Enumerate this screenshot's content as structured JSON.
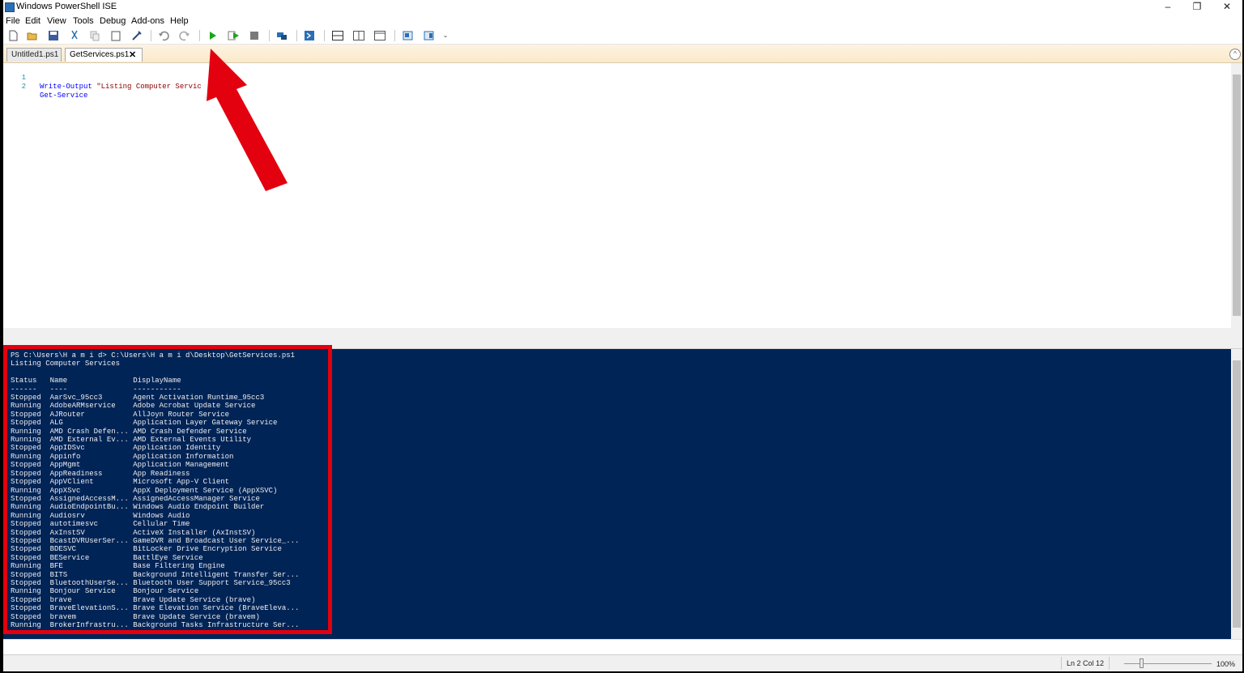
{
  "window": {
    "title": "Windows PowerShell ISE",
    "controls": [
      "–",
      "❐",
      "✕"
    ]
  },
  "menu": {
    "items": [
      "File",
      "Edit",
      "View",
      "Tools",
      "Debug",
      "Add-ons",
      "Help"
    ]
  },
  "toolbar": {
    "icons": [
      "new-icon",
      "open-icon",
      "save-icon",
      "cut-icon",
      "copy-icon",
      "paste-icon",
      "clear-console-icon",
      "undo-icon",
      "redo-icon",
      "run-script-icon",
      "run-selection-icon",
      "stop-icon",
      "remote-powershell-icon",
      "powershell-console-icon",
      "show-script-pane-top-icon",
      "show-script-pane-right-icon",
      "show-script-pane-maximized-icon",
      "show-command-window-icon",
      "show-command-addon-icon",
      "customize-toolbar-icon"
    ],
    "run_color": "#1aa51a"
  },
  "tabs": [
    {
      "label": "Untitled1.ps1",
      "active": false
    },
    {
      "label": "GetServices.ps1",
      "active": true,
      "close": "✕"
    }
  ],
  "editor": {
    "lines": [
      {
        "num": "1",
        "cmd": "Write-Output",
        "arg": " \"Listing Computer Servic"
      },
      {
        "num": "2",
        "cmd": "Get-Service",
        "arg": ""
      }
    ]
  },
  "console": {
    "background": "#012456",
    "prompt": "PS C:\\Users\\H a m i d> C:\\Users\\H a m i d\\Desktop\\GetServices.ps1",
    "heading": "Listing Computer Services",
    "columns": [
      "Status",
      "Name",
      "DisplayName"
    ],
    "separators": [
      "------",
      "----",
      "-----------"
    ],
    "rows": [
      [
        "Stopped",
        "AarSvc_95cc3",
        "Agent Activation Runtime_95cc3"
      ],
      [
        "Running",
        "AdobeARMservice",
        "Adobe Acrobat Update Service"
      ],
      [
        "Stopped",
        "AJRouter",
        "AllJoyn Router Service"
      ],
      [
        "Stopped",
        "ALG",
        "Application Layer Gateway Service"
      ],
      [
        "Running",
        "AMD Crash Defen...",
        "AMD Crash Defender Service"
      ],
      [
        "Running",
        "AMD External Ev...",
        "AMD External Events Utility"
      ],
      [
        "Stopped",
        "AppIDSvc",
        "Application Identity"
      ],
      [
        "Running",
        "Appinfo",
        "Application Information"
      ],
      [
        "Stopped",
        "AppMgmt",
        "Application Management"
      ],
      [
        "Stopped",
        "AppReadiness",
        "App Readiness"
      ],
      [
        "Stopped",
        "AppVClient",
        "Microsoft App-V Client"
      ],
      [
        "Running",
        "AppXSvc",
        "AppX Deployment Service (AppXSVC)"
      ],
      [
        "Stopped",
        "AssignedAccessM...",
        "AssignedAccessManager Service"
      ],
      [
        "Running",
        "AudioEndpointBu...",
        "Windows Audio Endpoint Builder"
      ],
      [
        "Running",
        "Audiosrv",
        "Windows Audio"
      ],
      [
        "Stopped",
        "autotimesvc",
        "Cellular Time"
      ],
      [
        "Stopped",
        "AxInstSV",
        "ActiveX Installer (AxInstSV)"
      ],
      [
        "Stopped",
        "BcastDVRUserSer...",
        "GameDVR and Broadcast User Service_..."
      ],
      [
        "Stopped",
        "BDESVC",
        "BitLocker Drive Encryption Service"
      ],
      [
        "Stopped",
        "BEService",
        "BattlEye Service"
      ],
      [
        "Running",
        "BFE",
        "Base Filtering Engine"
      ],
      [
        "Stopped",
        "BITS",
        "Background Intelligent Transfer Ser..."
      ],
      [
        "Stopped",
        "BluetoothUserSe...",
        "Bluetooth User Support Service_95cc3"
      ],
      [
        "Running",
        "Bonjour Service",
        "Bonjour Service"
      ],
      [
        "Stopped",
        "brave",
        "Brave Update Service (brave)"
      ],
      [
        "Stopped",
        "BraveElevationS...",
        "Brave Elevation Service (BraveEleva..."
      ],
      [
        "Stopped",
        "bravem",
        "Brave Update Service (bravem)"
      ],
      [
        "Running",
        "BrokerInfrastru...",
        "Background Tasks Infrastructure Ser..."
      ]
    ]
  },
  "status_bar": {
    "position": "Ln 2  Col 12",
    "zoom": "100%",
    "zoom_fraction": 0.19
  },
  "annotations": {
    "highlight_color": "#e3000f"
  }
}
